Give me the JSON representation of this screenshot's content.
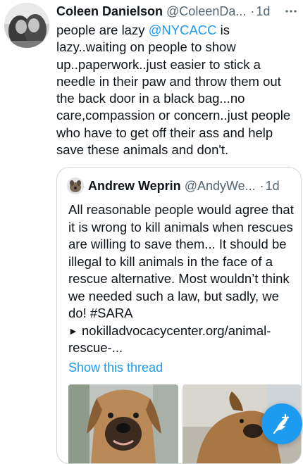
{
  "tweet": {
    "author": {
      "display_name": "Coleen Danielson",
      "handle": "@ColeenDa...",
      "separator": "·",
      "timestamp": "1d"
    },
    "more_icon": "more-horizontal-icon",
    "body": {
      "lead": "people are lazy ",
      "mention": "@NYCACC",
      "rest": " is lazy..waiting on people to show up..paperwork..just easier to stick a needle in their paw and throw them out the back door in a black bag...no care,compassion or concern..just people who have to get off their ass and help save these animals and don't."
    },
    "quoted_tweet": {
      "author": {
        "display_name": "Andrew Weprin",
        "handle": "@AndyWe...",
        "separator": "·",
        "timestamp": "1d"
      },
      "text": "All reasonable people would agree that it is wrong to kill animals when rescues are willing to save them... It should be illegal to kill animals in the face of a rescue alternative. Most wouldn’t think we needed such a law, but sadly, we do! #SARA",
      "link_arrow": "►",
      "link": "nokilladvocacycenter.org/animal-rescue-...",
      "show_thread_label": "Show this thread",
      "media": [
        "dog-photo",
        "dog-photo"
      ]
    }
  },
  "compose_button": {
    "icon": "compose-feather-icon"
  },
  "colors": {
    "accent": "#1d9bf0",
    "text": "#0f1419",
    "secondary_text": "#536471",
    "border": "#cfd9de",
    "background": "#ffffff"
  }
}
